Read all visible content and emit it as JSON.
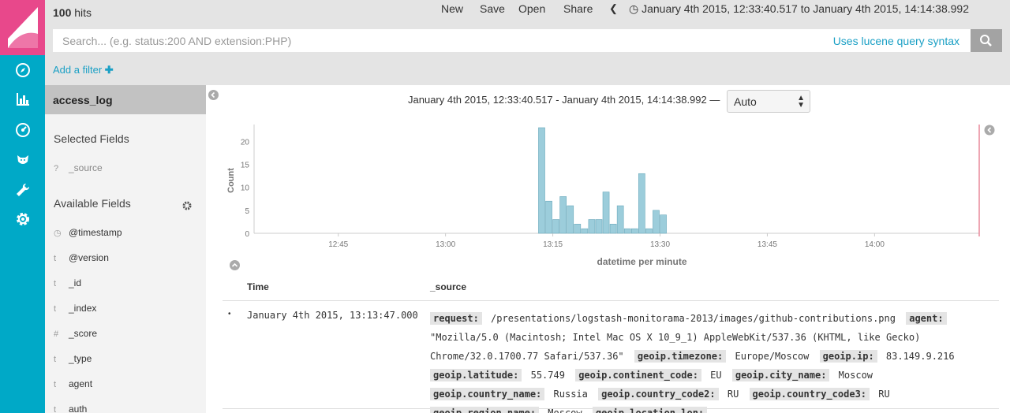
{
  "header": {
    "hits_count": "100",
    "hits_label": "hits",
    "menu": [
      "New",
      "Save",
      "Open",
      "Share"
    ],
    "time_range": "January 4th 2015, 12:33:40.517 to January 4th 2015, 14:14:38.992"
  },
  "search": {
    "placeholder": "Search... (e.g. status:200 AND extension:PHP)",
    "value": "",
    "syntax_link": "Uses lucene query syntax"
  },
  "filter": {
    "add_label": "Add a filter"
  },
  "nav_icons": [
    "discover-icon",
    "visualize-icon",
    "dashboard-icon",
    "timelion-icon",
    "dev-tools-icon",
    "management-icon"
  ],
  "sidebar": {
    "index": "access_log",
    "selected_title": "Selected Fields",
    "selected_fields": [
      {
        "type": "?",
        "name": "_source"
      }
    ],
    "available_title": "Available Fields",
    "available_fields": [
      {
        "type": "clock",
        "name": "@timestamp"
      },
      {
        "type": "t",
        "name": "@version"
      },
      {
        "type": "t",
        "name": "_id"
      },
      {
        "type": "t",
        "name": "_index"
      },
      {
        "type": "#",
        "name": "_score"
      },
      {
        "type": "t",
        "name": "_type"
      },
      {
        "type": "t",
        "name": "agent"
      },
      {
        "type": "t",
        "name": "auth"
      }
    ]
  },
  "histogram": {
    "range_text": "January 4th 2015, 12:33:40.517 - January 4th 2015, 14:14:38.992 —",
    "interval": "Auto"
  },
  "chart_data": {
    "type": "bar",
    "ylabel": "Count",
    "xlabel": "datetime per minute",
    "yticks": [
      "0",
      "5",
      "10",
      "15",
      "20"
    ],
    "ylim": [
      0,
      23
    ],
    "xticks": [
      "12:45",
      "13:00",
      "13:15",
      "13:30",
      "13:45",
      "14:00"
    ],
    "x_start": "12:33:40",
    "x_end": "14:14:38",
    "categories": [
      "13:13",
      "13:14",
      "13:15",
      "13:16",
      "13:17",
      "13:18",
      "13:19",
      "13:20",
      "13:21",
      "13:22",
      "13:23",
      "13:24",
      "13:25",
      "13:26",
      "13:27",
      "13:28",
      "13:29",
      "13:30"
    ],
    "values": [
      23,
      7,
      3,
      8,
      6,
      2,
      1,
      3,
      3,
      9,
      2,
      6,
      1,
      1,
      13,
      1,
      5,
      4
    ],
    "bar_color": "#9ccddb",
    "grid": false
  },
  "table": {
    "columns": [
      "Time",
      "_source"
    ],
    "rows": [
      {
        "time": "January 4th 2015, 13:13:47.000",
        "source": [
          {
            "k": "request:",
            "v": "/presentations/logstash-monitorama-2013/images/github-contributions.png"
          },
          {
            "k": "agent:",
            "v": "\"Mozilla/5.0 (Macintosh; Intel Mac OS X 10_9_1) AppleWebKit/537.36 (KHTML, like Gecko) Chrome/32.0.1700.77 Safari/537.36\""
          },
          {
            "k": "geoip.timezone:",
            "v": "Europe/Moscow"
          },
          {
            "k": "geoip.ip:",
            "v": "83.149.9.216"
          },
          {
            "k": "geoip.latitude:",
            "v": "55.749"
          },
          {
            "k": "geoip.continent_code:",
            "v": "EU"
          },
          {
            "k": "geoip.city_name:",
            "v": "Moscow"
          },
          {
            "k": "geoip.country_name:",
            "v": "Russia"
          },
          {
            "k": "geoip.country_code2:",
            "v": "RU"
          },
          {
            "k": "geoip.country_code3:",
            "v": "RU"
          },
          {
            "k": "geoip.region_name:",
            "v": "Moscow"
          },
          {
            "k": "geoip.location.lon:",
            "v": ""
          }
        ]
      }
    ]
  },
  "colors": {
    "brand": "#e8488b",
    "nav": "#00a9c7",
    "link": "#1ba0c5",
    "bar": "#9ccddb"
  }
}
